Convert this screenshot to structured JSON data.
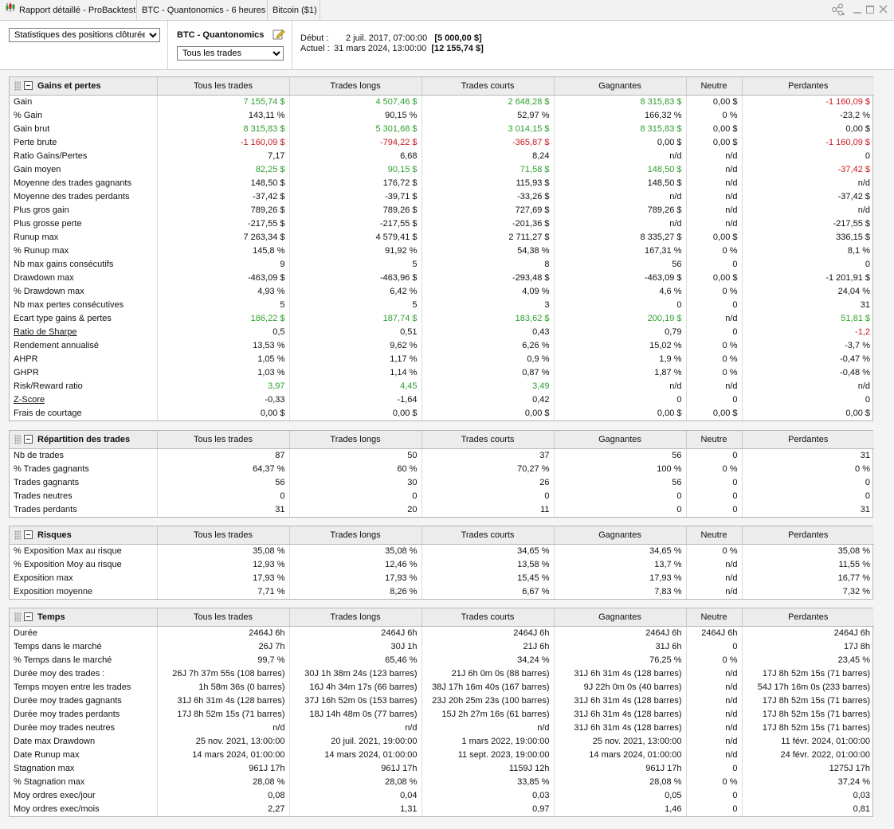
{
  "window": {
    "tabs": [
      "Rapport détaillé - ProBacktest",
      "BTC - Quantonomics - 6 heures",
      "Bitcoin ($1)"
    ]
  },
  "header": {
    "view_select": "Statistiques des positions clôturées",
    "system_name": "BTC - Quantonomics",
    "trade_filter": "Tous les trades",
    "start_label": "Début :",
    "start_date": "2 juil. 2017, 07:00:00",
    "start_value": "[5 000,00 $]",
    "current_label": "Actuel :",
    "current_date": "31 mars 2024, 13:00:00",
    "current_value": "[12 155,74 $]"
  },
  "columns": [
    "Tous les trades",
    "Trades longs",
    "Trades courts",
    "Gagnantes",
    "Neutre",
    "Perdantes"
  ],
  "colors": {
    "positive": "#2e9e2e",
    "negative": "#c8181e"
  },
  "sections": [
    {
      "title": "Gains et pertes",
      "rows": [
        {
          "label": "Gain",
          "values": [
            "7 155,74 $",
            "4 507,46 $",
            "2 648,28 $",
            "8 315,83 $",
            "0,00 $",
            "-1 160,09 $"
          ],
          "colors": [
            "g",
            "g",
            "g",
            "g",
            "",
            "r"
          ]
        },
        {
          "label": "% Gain",
          "values": [
            "143,11 %",
            "90,15 %",
            "52,97 %",
            "166,32 %",
            "0 %",
            "-23,2 %"
          ]
        },
        {
          "label": "Gain brut",
          "values": [
            "8 315,83 $",
            "5 301,68 $",
            "3 014,15 $",
            "8 315,83 $",
            "0,00 $",
            "0,00 $"
          ],
          "colors": [
            "g",
            "g",
            "g",
            "g",
            "",
            ""
          ]
        },
        {
          "label": "Perte brute",
          "values": [
            "-1 160,09 $",
            "-794,22 $",
            "-365,87 $",
            "0,00 $",
            "0,00 $",
            "-1 160,09 $"
          ],
          "colors": [
            "r",
            "r",
            "r",
            "",
            "",
            "r"
          ]
        },
        {
          "label": "Ratio Gains/Pertes",
          "values": [
            "7,17",
            "6,68",
            "8,24",
            "n/d",
            "n/d",
            "0"
          ]
        },
        {
          "label": "Gain moyen",
          "values": [
            "82,25 $",
            "90,15 $",
            "71,58 $",
            "148,50 $",
            "n/d",
            "-37,42 $"
          ],
          "colors": [
            "g",
            "g",
            "g",
            "g",
            "",
            "r"
          ]
        },
        {
          "label": "Moyenne des trades gagnants",
          "values": [
            "148,50 $",
            "176,72 $",
            "115,93 $",
            "148,50 $",
            "n/d",
            "n/d"
          ]
        },
        {
          "label": "Moyenne des trades perdants",
          "values": [
            "-37,42 $",
            "-39,71 $",
            "-33,26 $",
            "n/d",
            "n/d",
            "-37,42 $"
          ]
        },
        {
          "label": "Plus gros gain",
          "values": [
            "789,26 $",
            "789,26 $",
            "727,69 $",
            "789,26 $",
            "n/d",
            "n/d"
          ]
        },
        {
          "label": "Plus grosse perte",
          "values": [
            "-217,55 $",
            "-217,55 $",
            "-201,36 $",
            "n/d",
            "n/d",
            "-217,55 $"
          ]
        },
        {
          "label": "Runup max",
          "values": [
            "7 263,34 $",
            "4 579,41 $",
            "2 711,27 $",
            "8 335,27 $",
            "0,00 $",
            "336,15 $"
          ]
        },
        {
          "label": "% Runup max",
          "values": [
            "145,8 %",
            "91,92 %",
            "54,38 %",
            "167,31 %",
            "0 %",
            "8,1 %"
          ]
        },
        {
          "label": "Nb max gains consécutifs",
          "values": [
            "9",
            "5",
            "8",
            "56",
            "0",
            "0"
          ]
        },
        {
          "label": "Drawdown max",
          "values": [
            "-463,09 $",
            "-463,96 $",
            "-293,48 $",
            "-463,09 $",
            "0,00 $",
            "-1 201,91 $"
          ]
        },
        {
          "label": "% Drawdown max",
          "values": [
            "4,93 %",
            "6,42 %",
            "4,09 %",
            "4,6 %",
            "0 %",
            "24,04 %"
          ]
        },
        {
          "label": "Nb max pertes consécutives",
          "values": [
            "5",
            "5",
            "3",
            "0",
            "0",
            "31"
          ]
        },
        {
          "label": "Ecart type gains & pertes",
          "values": [
            "186,22 $",
            "187,74 $",
            "183,62 $",
            "200,19 $",
            "n/d",
            "51,81 $"
          ],
          "colors": [
            "g",
            "g",
            "g",
            "g",
            "",
            "g"
          ]
        },
        {
          "label": "Ratio de Sharpe",
          "underline": true,
          "values": [
            "0,5",
            "0,51",
            "0,43",
            "0,79",
            "0",
            "-1,2"
          ],
          "colors": [
            "",
            "",
            "",
            "",
            "",
            "r"
          ]
        },
        {
          "label": "Rendement annualisé",
          "values": [
            "13,53 %",
            "9,62 %",
            "6,26 %",
            "15,02 %",
            "0 %",
            "-3,7 %"
          ]
        },
        {
          "label": "AHPR",
          "values": [
            "1,05 %",
            "1,17 %",
            "0,9 %",
            "1,9 %",
            "0 %",
            "-0,47 %"
          ]
        },
        {
          "label": "GHPR",
          "values": [
            "1,03 %",
            "1,14 %",
            "0,87 %",
            "1,87 %",
            "0 %",
            "-0,48 %"
          ]
        },
        {
          "label": "Risk/Reward ratio",
          "values": [
            "3,97",
            "4,45",
            "3,49",
            "n/d",
            "n/d",
            "n/d"
          ],
          "colors": [
            "g",
            "g",
            "g",
            "",
            "",
            ""
          ]
        },
        {
          "label": "Z-Score",
          "underline": true,
          "values": [
            "-0,33",
            "-1,64",
            "0,42",
            "0",
            "0",
            "0"
          ]
        },
        {
          "label": "Frais de courtage",
          "values": [
            "0,00 $",
            "0,00 $",
            "0,00 $",
            "0,00 $",
            "0,00 $",
            "0,00 $"
          ]
        }
      ]
    },
    {
      "title": "Répartition des trades",
      "rows": [
        {
          "label": "Nb de trades",
          "values": [
            "87",
            "50",
            "37",
            "56",
            "0",
            "31"
          ]
        },
        {
          "label": "% Trades gagnants",
          "values": [
            "64,37 %",
            "60 %",
            "70,27 %",
            "100 %",
            "0 %",
            "0 %"
          ]
        },
        {
          "label": "Trades gagnants",
          "values": [
            "56",
            "30",
            "26",
            "56",
            "0",
            "0"
          ]
        },
        {
          "label": "Trades neutres",
          "values": [
            "0",
            "0",
            "0",
            "0",
            "0",
            "0"
          ]
        },
        {
          "label": "Trades perdants",
          "values": [
            "31",
            "20",
            "11",
            "0",
            "0",
            "31"
          ]
        }
      ]
    },
    {
      "title": "Risques",
      "rows": [
        {
          "label": "% Exposition Max au risque",
          "values": [
            "35,08 %",
            "35,08 %",
            "34,65 %",
            "34,65 %",
            "0 %",
            "35,08 %"
          ]
        },
        {
          "label": "% Exposition Moy au risque",
          "values": [
            "12,93 %",
            "12,46 %",
            "13,58 %",
            "13,7 %",
            "n/d",
            "11,55 %"
          ]
        },
        {
          "label": "Exposition max",
          "values": [
            "17,93 %",
            "17,93 %",
            "15,45 %",
            "17,93 %",
            "n/d",
            "16,77 %"
          ]
        },
        {
          "label": "Exposition moyenne",
          "values": [
            "7,71 %",
            "8,26 %",
            "6,67 %",
            "7,83 %",
            "n/d",
            "7,32 %"
          ]
        }
      ]
    },
    {
      "title": "Temps",
      "rows": [
        {
          "label": "Durée",
          "values": [
            "2464J 6h",
            "2464J 6h",
            "2464J 6h",
            "2464J 6h",
            "2464J 6h",
            "2464J 6h"
          ]
        },
        {
          "label": "Temps dans le marché",
          "values": [
            "26J 7h",
            "30J 1h",
            "21J 6h",
            "31J 6h",
            "0",
            "17J 8h"
          ]
        },
        {
          "label": "% Temps dans le marché",
          "values": [
            "99,7 %",
            "65,46 %",
            "34,24 %",
            "76,25 %",
            "0 %",
            "23,45 %"
          ]
        },
        {
          "label": "Durée moy des trades :",
          "values": [
            "26J 7h 37m 55s (108 barres)",
            "30J 1h 38m 24s (123 barres)",
            "21J 6h 0m 0s (88 barres)",
            "31J 6h 31m 4s (128 barres)",
            "n/d",
            "17J 8h 52m 15s (71 barres)"
          ]
        },
        {
          "label": "Temps moyen entre les trades",
          "values": [
            "1h 58m 36s (0 barres)",
            "16J 4h 34m 17s (66 barres)",
            "38J 17h 16m 40s (167 barres)",
            "9J 22h 0m 0s (40 barres)",
            "n/d",
            "54J 17h 16m 0s (233 barres)"
          ]
        },
        {
          "label": "Durée moy trades gagnants",
          "values": [
            "31J 6h 31m 4s (128 barres)",
            "37J 16h 52m 0s (153 barres)",
            "23J 20h 25m 23s (100 barres)",
            "31J 6h 31m 4s (128 barres)",
            "n/d",
            "17J 8h 52m 15s (71 barres)"
          ]
        },
        {
          "label": "Durée moy trades perdants",
          "values": [
            "17J 8h 52m 15s (71 barres)",
            "18J 14h 48m 0s (77 barres)",
            "15J 2h 27m 16s (61 barres)",
            "31J 6h 31m 4s (128 barres)",
            "n/d",
            "17J 8h 52m 15s (71 barres)"
          ]
        },
        {
          "label": "Durée moy trades neutres",
          "values": [
            "n/d",
            "n/d",
            "n/d",
            "31J 6h 31m 4s (128 barres)",
            "n/d",
            "17J 8h 52m 15s (71 barres)"
          ]
        },
        {
          "label": "Date max Drawdown",
          "values": [
            "25 nov. 2021, 13:00:00",
            "20 juil. 2021, 19:00:00",
            "1 mars 2022, 19:00:00",
            "25 nov. 2021, 13:00:00",
            "n/d",
            "11 févr. 2024, 01:00:00"
          ]
        },
        {
          "label": "Date Runup max",
          "values": [
            "14 mars 2024, 01:00:00",
            "14 mars 2024, 01:00:00",
            "11 sept. 2023, 19:00:00",
            "14 mars 2024, 01:00:00",
            "n/d",
            "24 févr. 2022, 01:00:00"
          ]
        },
        {
          "label": "Stagnation max",
          "values": [
            "961J 17h",
            "961J 17h",
            "1159J 12h",
            "961J 17h",
            "0",
            "1275J 17h"
          ]
        },
        {
          "label": "% Stagnation max",
          "values": [
            "28,08 %",
            "28,08 %",
            "33,85 %",
            "28,08 %",
            "0 %",
            "37,24 %"
          ]
        },
        {
          "label": "Moy ordres exec/jour",
          "values": [
            "0,08",
            "0,04",
            "0,03",
            "0,05",
            "0",
            "0,03"
          ]
        },
        {
          "label": "Moy ordres exec/mois",
          "values": [
            "2,27",
            "1,31",
            "0,97",
            "1,46",
            "0",
            "0,81"
          ]
        }
      ]
    }
  ]
}
